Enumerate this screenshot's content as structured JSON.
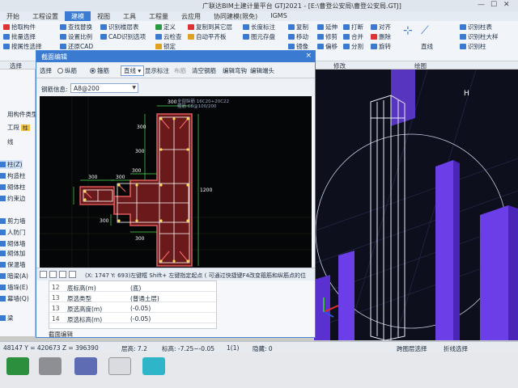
{
  "app": {
    "title": "广联达BIM土建计量平台 GTJ2021 - [E:\\曹登公安局\\曹登公安局.GTJ]"
  },
  "menu": [
    "开始",
    "工程设置",
    "建模",
    "视图",
    "工具",
    "工程量",
    "云应用",
    "协同建模(限免)",
    "IGMS"
  ],
  "ribbon": {
    "col1": [
      "拾取构件",
      "批量选择",
      "按属性选择"
    ],
    "col2": [
      "查找替换",
      "设置比例",
      "还原CAD"
    ],
    "col3": [
      "识别楼层表",
      "CAD识别选项"
    ],
    "col4": [
      "定义",
      "云检查",
      "锁定"
    ],
    "col5": [
      "复制到其它层",
      "自动平齐板",
      "图元存盘"
    ],
    "col6": [
      "长度标注",
      "图元存盘",
      "转换图元"
    ],
    "col7": [
      "复制",
      "移动",
      "镜像"
    ],
    "col8": [
      "延伸",
      "修剪",
      "偏移"
    ],
    "col9": [
      "打断",
      "合并",
      "分割"
    ],
    "col10": [
      "对齐",
      "删除",
      "旋转"
    ],
    "col11": [
      "直线",
      "识别柱表",
      "识别柱大样",
      "识别柱"
    ],
    "groups": [
      "选择",
      "修改",
      "绘图"
    ]
  },
  "left_panel": {
    "items": [
      {
        "label": "用构件类型"
      },
      {
        "label": "工段",
        "badge": "柱"
      },
      {
        "label": "线"
      },
      {
        "label": "柱(Z)",
        "selected": true
      },
      {
        "label": "构造柱"
      },
      {
        "label": "砌体柱"
      },
      {
        "label": "约束边"
      },
      {
        "label": "剪力墙"
      },
      {
        "label": "人防门"
      },
      {
        "label": "砌体墙"
      },
      {
        "label": "砌体加"
      },
      {
        "label": "保温墙"
      },
      {
        "label": "暗梁(A)"
      },
      {
        "label": "墙垛(E)"
      },
      {
        "label": "幕墙(Q)"
      },
      {
        "label": "梁"
      }
    ]
  },
  "dialog": {
    "title": "截面编辑",
    "close": "×",
    "toolbar": {
      "select": "选择",
      "radio_longitudinal": "纵筋",
      "radio_stirrup": "箍筋",
      "line_mode": "直线",
      "show_marks": "显示标注",
      "layout": "布筋",
      "clear_rebar": "清空钢筋",
      "edit_hook": "编辑弯钩",
      "edit_end": "编辑端头"
    },
    "rebar_label": "钢筋信息:",
    "rebar_value": "A8@200",
    "canvas_info": [
      "全部纵筋 16C20+20C22",
      "箍筋   C8@100/200"
    ],
    "dims": [
      "300",
      "300",
      "300",
      "300",
      "300",
      "300",
      "1200",
      "300",
      "300"
    ],
    "status_text": "(X: 1747 Y: 693)左键框 Shift+ 左键指定起点 ( 可通过快捷键F4改变箍筋和纵筋点的位"
  },
  "properties": {
    "rows": [
      {
        "num": "12",
        "key": "底标高(m)",
        "value": "(底)"
      },
      {
        "num": "13",
        "key": "原选类型",
        "value": "(普通土层)"
      },
      {
        "num": "13",
        "key": "原选高度(m)",
        "value": "(-0.05)"
      },
      {
        "num": "14",
        "key": "原选标高(m)",
        "value": "(-0.05)"
      }
    ],
    "tab": "截面编辑"
  },
  "statusbar": {
    "coords": "48147 Y = 420673 Z = 396390",
    "layer_height": "层高: 7.2",
    "elevation": "标高: -7.25~-0.05",
    "selected": "1(1)",
    "hidden": "隐藏: 0",
    "snap": "跨图层选择",
    "fold": "折线选择"
  },
  "colors": {
    "accent": "#3a7ad0",
    "canvas_bg": "#050608",
    "section_outline": "#e05a5a",
    "dimension": "#4ddc4d",
    "column_3d": "#6b3ee8"
  }
}
